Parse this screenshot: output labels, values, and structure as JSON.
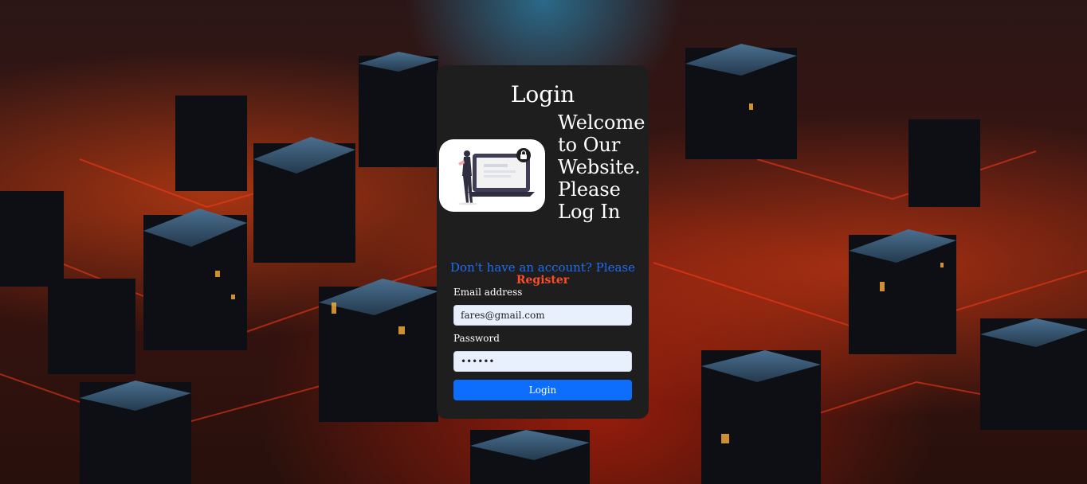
{
  "login": {
    "title": "Login",
    "welcome": "Welcome to Our Website. Please Log In",
    "register_prompt": "Don't have an account? Please",
    "register_link": "Register",
    "email_label": "Email address",
    "email_value": "fares@gmail.com",
    "password_label": "Password",
    "password_value": "••••••",
    "submit_label": "Login"
  },
  "colors": {
    "card": "#1e1e1e",
    "primary": "#0d6efd",
    "register_link": "#ff4d2a",
    "register_prompt": "#1e6cf3"
  },
  "icons": {
    "illustration": "person-with-laptop-illustration",
    "lock": "lock-icon"
  }
}
